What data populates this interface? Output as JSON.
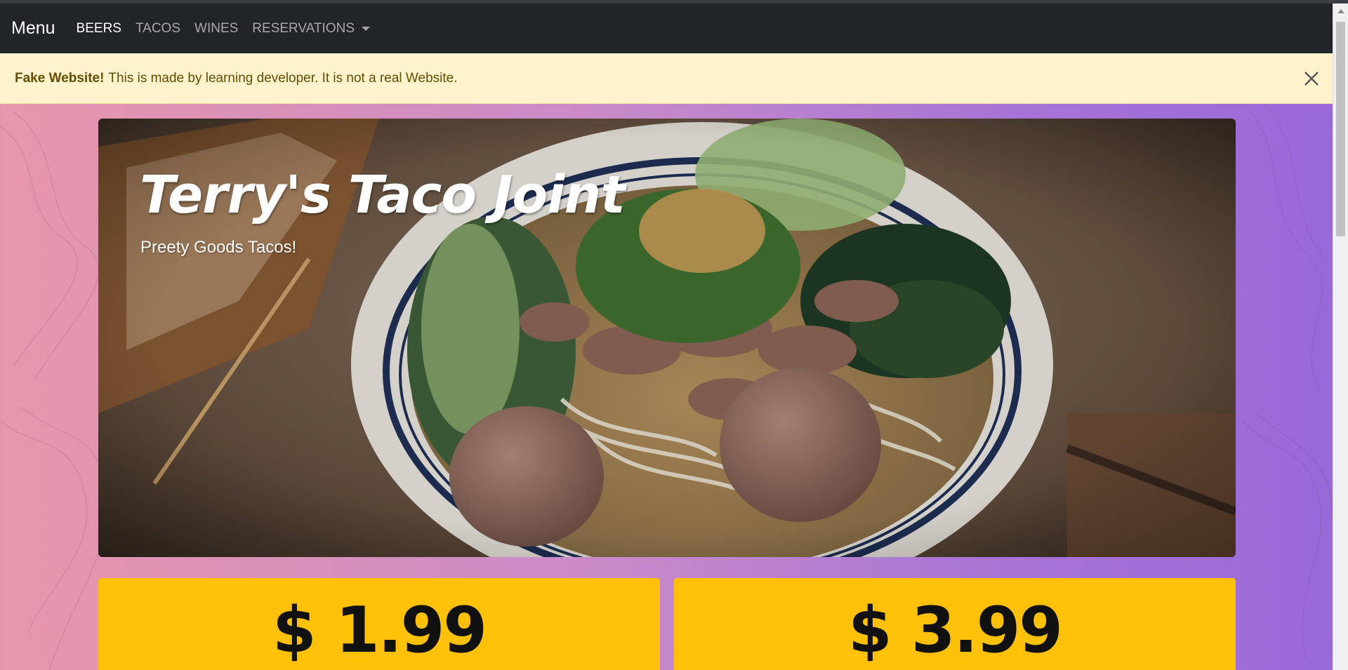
{
  "navbar": {
    "brand": "Menu",
    "items": [
      {
        "label": "BEERS",
        "active": true
      },
      {
        "label": "TACOS",
        "active": false
      },
      {
        "label": "WINES",
        "active": false
      },
      {
        "label": "RESERVATIONS",
        "active": false,
        "dropdown": true
      }
    ],
    "background": "#212529"
  },
  "alert": {
    "strong": "Fake Website!",
    "message": "This is made by learning developer. It is not a real Website.",
    "close_icon": "close-icon",
    "background": "#fff3cd"
  },
  "hero": {
    "title": "Terry's Taco Joint",
    "subtitle": "Preety Goods Tacos!",
    "image": "noodle-soup-bowl"
  },
  "prices": [
    {
      "label": "$ 1.99"
    },
    {
      "label": "$ 3.99"
    }
  ],
  "colors": {
    "card": "#ffc107",
    "gradient_start": "#e896ab",
    "gradient_end": "#9968d8"
  }
}
